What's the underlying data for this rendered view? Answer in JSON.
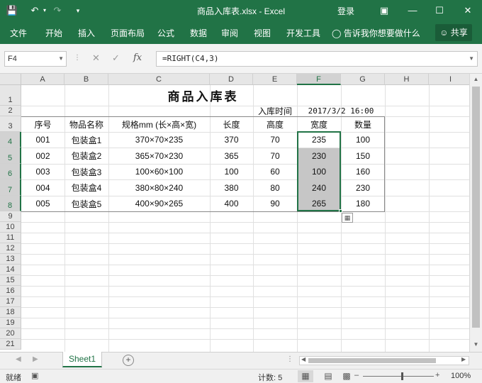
{
  "title_bar": {
    "document_title": "商品入库表.xlsx  -  Excel",
    "login": "登录",
    "save_icon": "save-icon",
    "undo_icon": "undo-icon",
    "redo_icon": "redo-icon"
  },
  "ribbon": {
    "tabs": [
      "文件",
      "开始",
      "插入",
      "页面布局",
      "公式",
      "数据",
      "审阅",
      "视图",
      "开发工具"
    ],
    "tell_me": "告诉我你想要做什么",
    "share": "共享"
  },
  "formula_bar": {
    "name_box": "F4",
    "formula": "=RIGHT(C4,3)"
  },
  "columns": [
    "A",
    "B",
    "C",
    "D",
    "E",
    "F",
    "G",
    "H",
    "I"
  ],
  "rows": [
    "1",
    "2",
    "3",
    "4",
    "5",
    "6",
    "7",
    "8",
    "9",
    "10",
    "11",
    "12",
    "13",
    "14",
    "15",
    "16",
    "17",
    "18",
    "19",
    "20",
    "21"
  ],
  "sheet": {
    "title": "商品入库表",
    "stock_time_label": "入库时间",
    "stock_time_value": "2017/3/2 16:00",
    "headers": [
      "序号",
      "物品名称",
      "规格mm (长×高×宽)",
      "长度",
      "高度",
      "宽度",
      "数量"
    ],
    "data": [
      [
        "001",
        "包装盒1",
        "370×70×235",
        "370",
        "70",
        "235",
        "100"
      ],
      [
        "002",
        "包装盒2",
        "365×70×230",
        "365",
        "70",
        "230",
        "150"
      ],
      [
        "003",
        "包装盒3",
        "100×60×100",
        "100",
        "60",
        "100",
        "160"
      ],
      [
        "004",
        "包装盒4",
        "380×80×240",
        "380",
        "80",
        "240",
        "230"
      ],
      [
        "005",
        "包装盒5",
        "400×90×265",
        "400",
        "90",
        "265",
        "180"
      ]
    ]
  },
  "sheet_tabs": [
    "Sheet1"
  ],
  "status_bar": {
    "ready": "就绪",
    "count": "计数: 5",
    "zoom": "100%"
  }
}
